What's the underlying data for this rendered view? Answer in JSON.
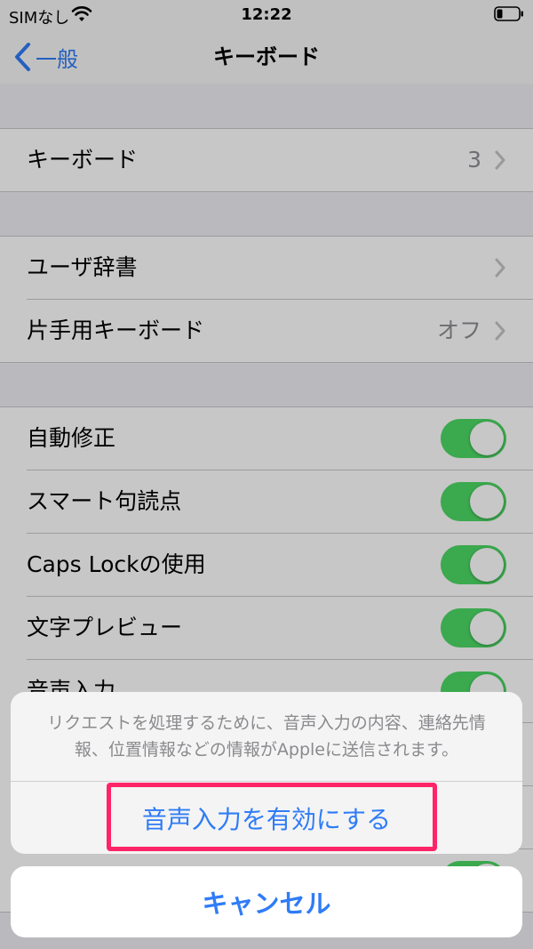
{
  "status_bar": {
    "carrier": "SIMなし",
    "time": "12:22"
  },
  "nav": {
    "back_label": "一般",
    "title": "キーボード"
  },
  "group1": [
    {
      "label": "キーボード",
      "value": "3"
    }
  ],
  "group2": [
    {
      "label": "ユーザ辞書",
      "value": ""
    },
    {
      "label": "片手用キーボード",
      "value": "オフ"
    }
  ],
  "group3": [
    {
      "label": "自動修正",
      "on": true
    },
    {
      "label": "スマート句読点",
      "on": true
    },
    {
      "label": "Caps Lockの使用",
      "on": true
    },
    {
      "label": "文字プレビュー",
      "on": true
    },
    {
      "label": "音声入力",
      "on": true
    }
  ],
  "sheet": {
    "message_line1": "リクエストを処理するために、音声入力の内容、連絡先情",
    "message_line2": "報、位置情報などの情報がAppleに送信されます。",
    "action_label": "音声入力を有効にする",
    "cancel_label": "キャンセル"
  },
  "colors": {
    "accent": "#2f7cf6",
    "toggle_on": "#4cd964",
    "highlight": "#ff2468"
  }
}
